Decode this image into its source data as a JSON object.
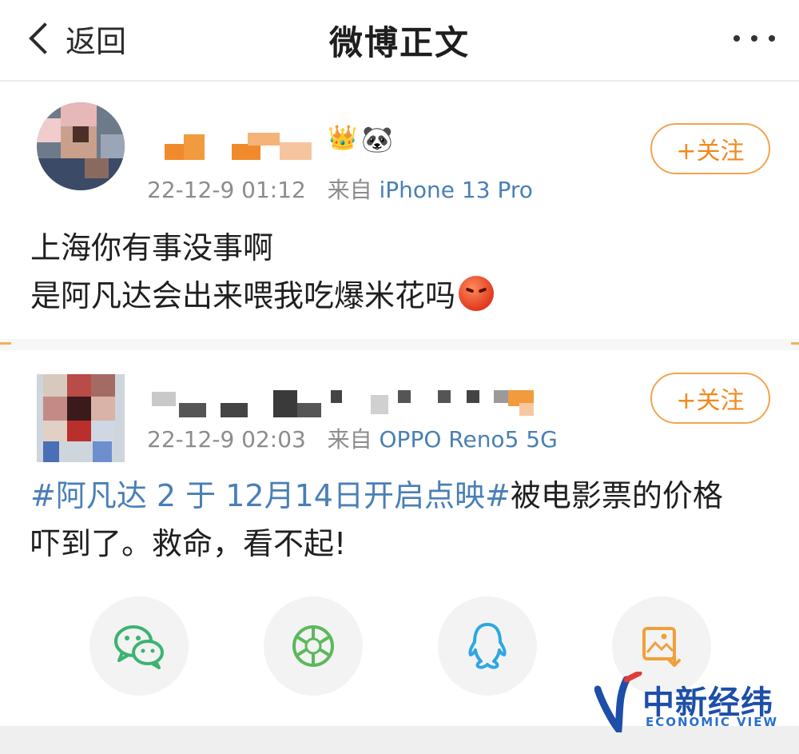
{
  "nav": {
    "back_label": "返回",
    "title": "微博正文"
  },
  "posts": [
    {
      "username": "[blurred]",
      "time": "22-12-9 01:12",
      "source_prefix": "来自",
      "source": "iPhone 13 Pro",
      "follow_label": "+关注",
      "content_line1": "上海你有事没事啊",
      "content_line2": "是阿凡达会出来喂我吃爆米花吗",
      "emoji": "angry-face"
    },
    {
      "username": "[blurred]",
      "time": "22-12-9 02:03",
      "source_prefix": "来自",
      "source": "OPPO Reno5 5G",
      "follow_label": "+关注",
      "hashtag": "#阿凡达 2 于 12月14日开启点映#",
      "content_tail": "被电影票的价格",
      "content_line2": "吓到了。救命，看不起!"
    }
  ],
  "share": {
    "items": [
      {
        "icon": "wechat-icon",
        "color": "#3cb371"
      },
      {
        "icon": "moments-icon",
        "color": "#5cb85c"
      },
      {
        "icon": "qq-icon",
        "color": "#2ea7e0"
      },
      {
        "icon": "save-image-icon",
        "color": "#f0a03a"
      }
    ]
  },
  "watermark": {
    "cn": "中新经纬",
    "en": "ECONOMIC VIEW"
  },
  "colors": {
    "accent_orange": "#f08a1f",
    "link_blue": "#4a7fb6"
  }
}
